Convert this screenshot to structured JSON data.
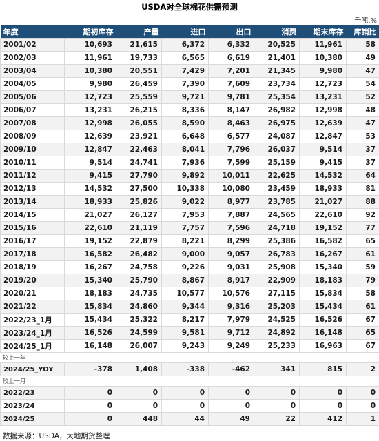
{
  "document": {
    "title": "USDA对全球棉花供需预测",
    "unit_note": "千吨,%",
    "source_note": "数据来源：USDA，大地期货整理"
  },
  "table": {
    "columns": [
      {
        "key": "year",
        "label": "年度",
        "align": "left"
      },
      {
        "key": "begin",
        "label": "期初库存",
        "align": "right"
      },
      {
        "key": "prod",
        "label": "产量",
        "align": "right"
      },
      {
        "key": "import",
        "label": "进口",
        "align": "right"
      },
      {
        "key": "export",
        "label": "出口",
        "align": "right"
      },
      {
        "key": "consume",
        "label": "消费",
        "align": "right"
      },
      {
        "key": "end",
        "label": "期末库存",
        "align": "right"
      },
      {
        "key": "ratio",
        "label": "库销比",
        "align": "right"
      }
    ],
    "rows": [
      {
        "year": "2001/02",
        "begin": "10,693",
        "prod": "21,615",
        "import": "6,372",
        "export": "6,332",
        "consume": "20,525",
        "end": "11,961",
        "ratio": "58"
      },
      {
        "year": "2002/03",
        "begin": "11,961",
        "prod": "19,733",
        "import": "6,565",
        "export": "6,619",
        "consume": "21,401",
        "end": "10,380",
        "ratio": "49"
      },
      {
        "year": "2003/04",
        "begin": "10,380",
        "prod": "20,551",
        "import": "7,429",
        "export": "7,201",
        "consume": "21,345",
        "end": "9,980",
        "ratio": "47"
      },
      {
        "year": "2004/05",
        "begin": "9,980",
        "prod": "26,459",
        "import": "7,390",
        "export": "7,609",
        "consume": "23,734",
        "end": "12,723",
        "ratio": "54"
      },
      {
        "year": "2005/06",
        "begin": "12,723",
        "prod": "25,559",
        "import": "9,721",
        "export": "9,781",
        "consume": "25,354",
        "end": "13,231",
        "ratio": "52"
      },
      {
        "year": "2006/07",
        "begin": "13,231",
        "prod": "26,215",
        "import": "8,336",
        "export": "8,147",
        "consume": "26,982",
        "end": "12,998",
        "ratio": "48"
      },
      {
        "year": "2007/08",
        "begin": "12,998",
        "prod": "26,055",
        "import": "8,590",
        "export": "8,463",
        "consume": "26,975",
        "end": "12,639",
        "ratio": "47"
      },
      {
        "year": "2008/09",
        "begin": "12,639",
        "prod": "23,921",
        "import": "6,648",
        "export": "6,577",
        "consume": "24,087",
        "end": "12,847",
        "ratio": "53"
      },
      {
        "year": "2009/10",
        "begin": "12,847",
        "prod": "22,463",
        "import": "8,041",
        "export": "7,796",
        "consume": "26,037",
        "end": "9,514",
        "ratio": "37"
      },
      {
        "year": "2010/11",
        "begin": "9,514",
        "prod": "24,741",
        "import": "7,936",
        "export": "7,599",
        "consume": "25,159",
        "end": "9,415",
        "ratio": "37"
      },
      {
        "year": "2011/12",
        "begin": "9,415",
        "prod": "27,790",
        "import": "9,892",
        "export": "10,011",
        "consume": "22,625",
        "end": "14,532",
        "ratio": "64"
      },
      {
        "year": "2012/13",
        "begin": "14,532",
        "prod": "27,500",
        "import": "10,338",
        "export": "10,080",
        "consume": "23,459",
        "end": "18,933",
        "ratio": "81"
      },
      {
        "year": "2013/14",
        "begin": "18,933",
        "prod": "25,826",
        "import": "9,022",
        "export": "8,977",
        "consume": "23,785",
        "end": "21,027",
        "ratio": "88"
      },
      {
        "year": "2014/15",
        "begin": "21,027",
        "prod": "26,127",
        "import": "7,953",
        "export": "7,887",
        "consume": "24,565",
        "end": "22,610",
        "ratio": "92"
      },
      {
        "year": "2015/16",
        "begin": "22,610",
        "prod": "21,119",
        "import": "7,757",
        "export": "7,596",
        "consume": "24,718",
        "end": "19,152",
        "ratio": "77"
      },
      {
        "year": "2016/17",
        "begin": "19,152",
        "prod": "22,879",
        "import": "8,221",
        "export": "8,299",
        "consume": "25,386",
        "end": "16,582",
        "ratio": "65"
      },
      {
        "year": "2017/18",
        "begin": "16,582",
        "prod": "26,482",
        "import": "9,000",
        "export": "9,057",
        "consume": "26,783",
        "end": "16,267",
        "ratio": "61"
      },
      {
        "year": "2018/19",
        "begin": "16,267",
        "prod": "24,758",
        "import": "9,226",
        "export": "9,031",
        "consume": "25,908",
        "end": "15,340",
        "ratio": "59"
      },
      {
        "year": "2019/20",
        "begin": "15,340",
        "prod": "25,790",
        "import": "8,867",
        "export": "8,917",
        "consume": "22,909",
        "end": "18,183",
        "ratio": "79"
      },
      {
        "year": "2020/21",
        "begin": "18,183",
        "prod": "24,735",
        "import": "10,577",
        "export": "10,576",
        "consume": "27,115",
        "end": "15,834",
        "ratio": "58"
      },
      {
        "year": "2021/22",
        "begin": "15,834",
        "prod": "24,860",
        "import": "9,344",
        "export": "9,316",
        "consume": "25,203",
        "end": "15,434",
        "ratio": "61"
      },
      {
        "year": "2022/23_1月",
        "begin": "15,434",
        "prod": "25,322",
        "import": "8,217",
        "export": "7,979",
        "consume": "24,525",
        "end": "16,526",
        "ratio": "67"
      },
      {
        "year": "2023/24_1月",
        "begin": "16,526",
        "prod": "24,599",
        "import": "9,581",
        "export": "9,712",
        "consume": "24,892",
        "end": "16,148",
        "ratio": "65"
      },
      {
        "year": "2024/25_1月",
        "begin": "16,148",
        "prod": "26,007",
        "import": "9,243",
        "export": "9,249",
        "consume": "25,233",
        "end": "16,963",
        "ratio": "67"
      }
    ],
    "section_yoy": {
      "label": "较上一年",
      "rows": [
        {
          "year": "2024/25_YOY",
          "begin": "-378",
          "prod": "1,408",
          "import": "-338",
          "export": "-462",
          "consume": "341",
          "end": "815",
          "ratio": "2"
        }
      ]
    },
    "section_mom": {
      "label": "较上一月",
      "rows": [
        {
          "year": "2022/23",
          "begin": "0",
          "prod": "0",
          "import": "0",
          "export": "0",
          "consume": "0",
          "end": "0",
          "ratio": "0"
        },
        {
          "year": "2023/24",
          "begin": "0",
          "prod": "0",
          "import": "0",
          "export": "0",
          "consume": "0",
          "end": "0",
          "ratio": "0"
        },
        {
          "year": "2024/25",
          "begin": "0",
          "prod": "448",
          "import": "44",
          "export": "49",
          "consume": "22",
          "end": "412",
          "ratio": "1"
        }
      ]
    }
  },
  "colors": {
    "header_bg": "#1f4e79",
    "header_text": "#ffffff",
    "stripe": "#f2f2f2",
    "border": "#d9d9d9"
  }
}
